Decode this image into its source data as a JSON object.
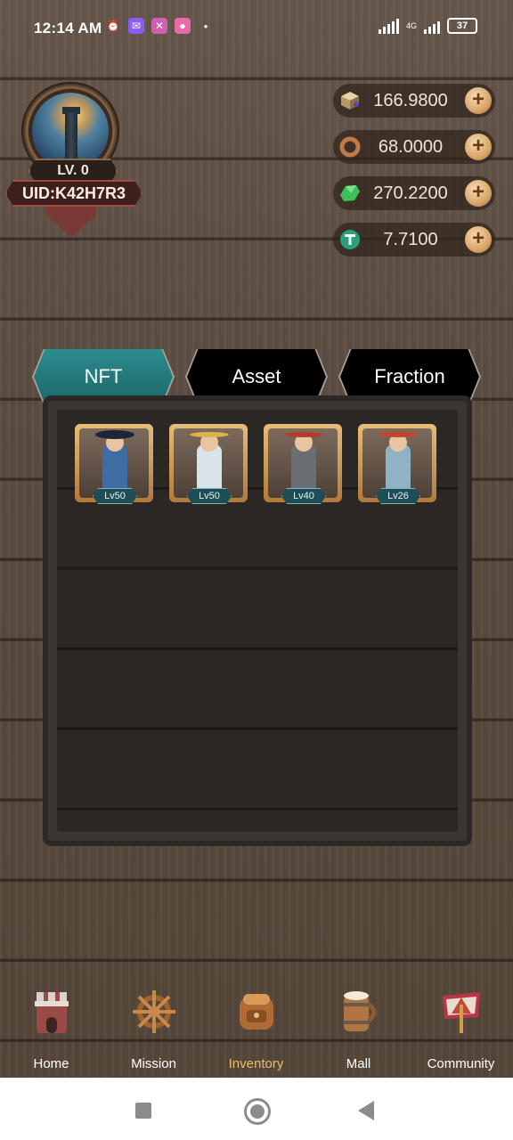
{
  "status_bar": {
    "time": "12:14 AM",
    "network": "4G",
    "battery": "37"
  },
  "profile": {
    "level": "LV. 0",
    "uid": "UID:K42H7R3"
  },
  "currencies": [
    {
      "name": "cube",
      "value": "166.9800",
      "icon": "cube-icon",
      "color": "#c9a97a"
    },
    {
      "name": "ring",
      "value": "68.0000",
      "icon": "copper-ring-icon",
      "color": "#b46a3a"
    },
    {
      "name": "gem",
      "value": "270.2200",
      "icon": "green-crystal-icon",
      "color": "#3fbf5a"
    },
    {
      "name": "usdt",
      "value": "7.7100",
      "icon": "tether-icon",
      "color": "#26a17b"
    }
  ],
  "tabs": [
    {
      "label": "NFT",
      "active": true
    },
    {
      "label": "Asset",
      "active": false
    },
    {
      "label": "Fraction",
      "active": false
    }
  ],
  "inventory": {
    "cards": [
      {
        "level": "Lv50",
        "character": "blue-coat-captain"
      },
      {
        "level": "Lv50",
        "character": "white-uniform-officer"
      },
      {
        "level": "Lv40",
        "character": "bearded-pirate"
      },
      {
        "level": "Lv26",
        "character": "bandana-mechanic"
      }
    ]
  },
  "nav": {
    "items": [
      {
        "label": "Home",
        "icon": "tower-icon",
        "active": false
      },
      {
        "label": "Mission",
        "icon": "ship-wheel-icon",
        "active": false
      },
      {
        "label": "Inventory",
        "icon": "backpack-icon",
        "active": true
      },
      {
        "label": "Mall",
        "icon": "barrel-mug-icon",
        "active": false
      },
      {
        "label": "Community",
        "icon": "banner-icon",
        "active": false
      }
    ]
  },
  "colors": {
    "tab_active": "#2c8c8f",
    "nav_active": "#e8c063",
    "uid_border": "#a34a42"
  }
}
